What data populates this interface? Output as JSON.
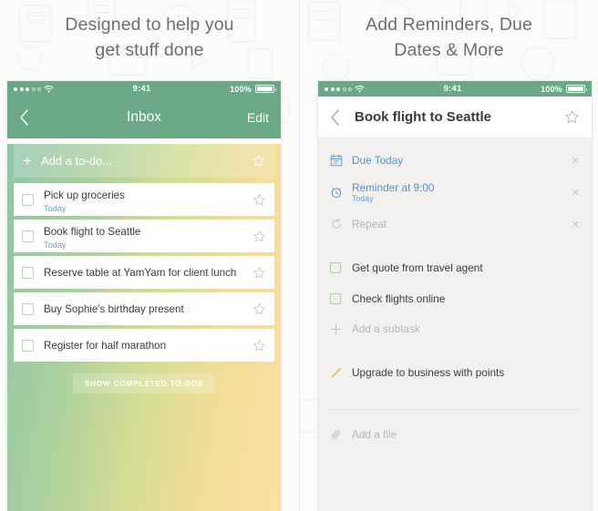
{
  "panels": {
    "left": {
      "headline_line1": "Designed to help you",
      "headline_line2": "get stuff done",
      "status_bar": {
        "time": "9:41",
        "battery_percent": "100%",
        "wifi_icon": "wifi-icon",
        "signal_icon": "signal-dots-icon"
      },
      "nav": {
        "back_icon": "chevron-left-icon",
        "title": "Inbox",
        "edit_label": "Edit"
      },
      "add_row": {
        "plus_icon": "plus-icon",
        "placeholder": "Add a to-do...",
        "star_icon": "star-outline-icon"
      },
      "todos": [
        {
          "title": "Pick up groceries",
          "subtitle": "Today",
          "checkbox_icon": "checkbox-empty-icon",
          "star_icon": "star-outline-icon"
        },
        {
          "title": "Book flight to Seattle",
          "subtitle": "Today",
          "checkbox_icon": "checkbox-empty-icon",
          "star_icon": "star-outline-icon"
        },
        {
          "title": "Reserve table at YamYam for client lunch",
          "subtitle": "",
          "checkbox_icon": "checkbox-empty-icon",
          "star_icon": "star-outline-icon"
        },
        {
          "title": "Buy Sophie's birthday present",
          "subtitle": "",
          "checkbox_icon": "checkbox-empty-icon",
          "star_icon": "star-outline-icon"
        },
        {
          "title": "Register for half marathon",
          "subtitle": "",
          "checkbox_icon": "checkbox-empty-icon",
          "star_icon": "star-outline-icon"
        }
      ],
      "show_completed_label": "SHOW COMPLETED TO-DOS"
    },
    "right": {
      "headline_line1": "Add Reminders, Due",
      "headline_line2": "Dates & More",
      "status_bar": {
        "time": "9:41",
        "battery_percent": "100%",
        "wifi_icon": "wifi-icon",
        "signal_icon": "signal-dots-icon"
      },
      "nav": {
        "back_icon": "chevron-left-icon",
        "title": "Book flight to Seattle",
        "star_icon": "star-outline-icon"
      },
      "attributes": [
        {
          "icon": "calendar-icon",
          "label": "Due Today",
          "sub": "",
          "state": "active",
          "remove_icon": "close-x-icon"
        },
        {
          "icon": "alarm-clock-icon",
          "label": "Reminder at 9:00",
          "sub": "Today",
          "state": "active",
          "remove_icon": "close-x-icon"
        },
        {
          "icon": "repeat-icon",
          "label": "Repeat",
          "sub": "",
          "state": "muted",
          "remove_icon": "close-x-icon"
        }
      ],
      "subtasks": [
        {
          "title": "Get quote from travel agent",
          "checkbox_icon": "checkbox-empty-green-icon"
        },
        {
          "title": "Check flights online",
          "checkbox_icon": "checkbox-empty-green-icon"
        }
      ],
      "add_subtask": {
        "icon": "plus-icon",
        "label": "Add a subtask"
      },
      "note": {
        "icon": "pencil-icon",
        "text": "Upgrade to business with points"
      },
      "add_file": {
        "icon": "paperclip-icon",
        "label": "Add a file"
      }
    }
  },
  "colors": {
    "brand_green": "#6aa886",
    "accent_blue": "#5b8fc7",
    "note_gold": "#d9bd6a",
    "muted_grey": "#b6b5b2",
    "right_bg": "#f2f1ef"
  }
}
